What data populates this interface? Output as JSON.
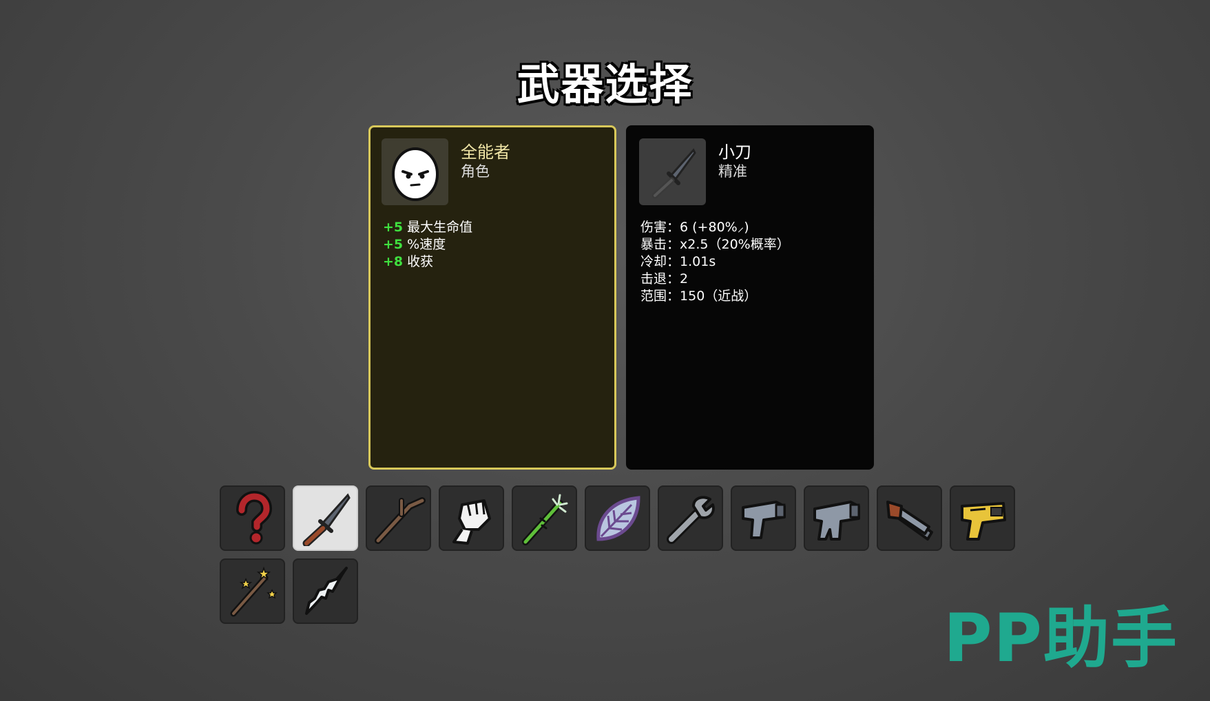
{
  "screen_title": "武器选择",
  "character": {
    "name": "全能者",
    "type": "角色",
    "icon": "egg-face-icon",
    "bonuses": [
      {
        "value": "+5",
        "label": "最大生命值"
      },
      {
        "value": "+5",
        "label": "%速度"
      },
      {
        "value": "+8",
        "label": "收获"
      }
    ],
    "accent_color": "#d8c85a",
    "bonus_color": "#3fe03f"
  },
  "weapon": {
    "name": "小刀",
    "type": "精准",
    "icon": "knife-icon",
    "stats": [
      {
        "label": "伤害：",
        "value": "6 (+80%⸝)"
      },
      {
        "label": "暴击：",
        "value": "x2.5（20%概率）"
      },
      {
        "label": "冷却：",
        "value": "1.01s"
      },
      {
        "label": "击退：",
        "value": "2"
      },
      {
        "label": "范围：",
        "value": "150（近战）"
      }
    ]
  },
  "weapon_slots": [
    {
      "icon": "random-question-icon",
      "selected": false
    },
    {
      "icon": "knife-icon",
      "selected": true
    },
    {
      "icon": "stick-icon",
      "selected": false
    },
    {
      "icon": "fist-icon",
      "selected": false
    },
    {
      "icon": "thorny-club-icon",
      "selected": false
    },
    {
      "icon": "leaf-icon",
      "selected": false
    },
    {
      "icon": "wrench-icon",
      "selected": false
    },
    {
      "icon": "pistol-icon",
      "selected": false
    },
    {
      "icon": "smg-icon",
      "selected": false
    },
    {
      "icon": "double-barrel-icon",
      "selected": false
    },
    {
      "icon": "taser-icon",
      "selected": false
    },
    {
      "icon": "magic-wand-icon",
      "selected": false
    },
    {
      "icon": "ice-shard-icon",
      "selected": false
    }
  ],
  "watermark": "PP助手"
}
